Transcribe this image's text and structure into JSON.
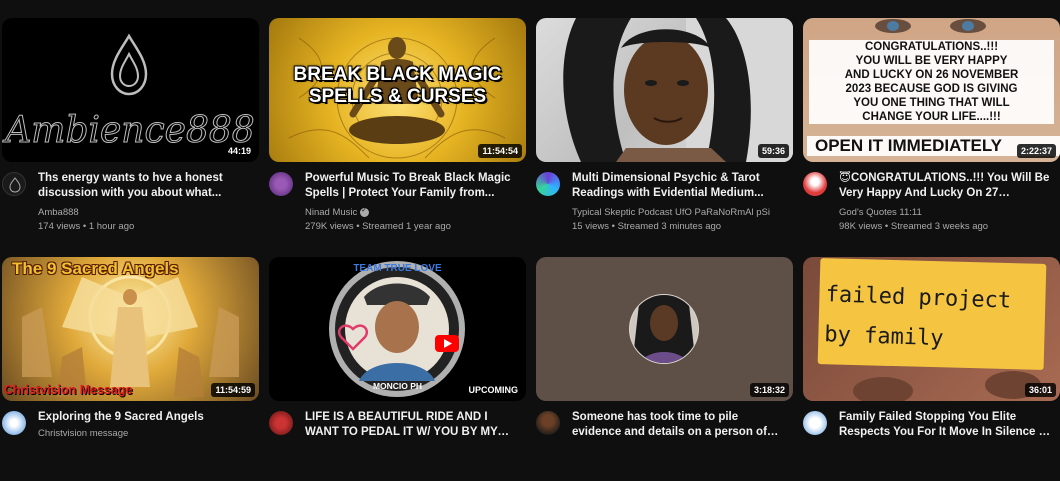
{
  "videos": [
    {
      "thumb_text": "Ambience888",
      "duration": "44:19",
      "title": "Ths energy wants to hve a honest discussion with you about what...",
      "channel": "Amba888",
      "stats": "174 views • 1 hour ago"
    },
    {
      "thumb_text": "BREAK BLACK MAGIC\nSPELLS & CURSES",
      "duration": "11:54:54",
      "title": "Powerful Music To Break Black Magic Spells | Protect Your Family from...",
      "channel": "Ninad Music",
      "stats": "279K views • Streamed 1 year ago"
    },
    {
      "duration": "59:36",
      "title": "Multi Dimensional Psychic & Tarot Readings with Evidential Medium...",
      "channel": "Typical Skeptic Podcast UfO PaRaNoRmAl pSi",
      "stats": "15 views • Streamed 3 minutes ago"
    },
    {
      "thumb_text": "CONGRATULATIONS..!!!\nYOU WILL BE VERY HAPPY\nAND LUCKY ON 26 NOVEMBER\n2023 BECAUSE GOD IS GIVING\nYOU ONE THING THAT WILL\nCHANGE YOUR LIFE....!!!",
      "thumb_text_big": "OPEN IT IMMEDIATELY",
      "duration": "2:22:37",
      "title": "😇CONGRATULATIONS..!!! You Will Be Very Happy And Lucky On 27 November...",
      "channel": "God's Quotes 11:11",
      "stats": "98K views • Streamed 3 weeks ago"
    },
    {
      "thumb_text": "The 9 Sacred Angels",
      "thumb_text_bottom": "Christvision Message",
      "duration": "11:54:59",
      "title": "Exploring the 9 Sacred Angels",
      "channel": "Christvision message",
      "stats": ""
    },
    {
      "thumb_text": "TEAM TRUE LOVE",
      "thumb_text_bottom": "MONCIO PH",
      "duration": "UPCOMING",
      "title": "LIFE IS A BEAUTIFUL RIDE AND I WANT TO PEDAL IT W/ YOU BY MY SIDE...",
      "channel": "",
      "stats": ""
    },
    {
      "duration": "3:18:32",
      "title": "Someone has took time to pile evidence and details on a person of high honor....",
      "channel": "",
      "stats": ""
    },
    {
      "thumb_text": "failed project\nby family",
      "duration": "36:01",
      "title": "Family Failed Stopping You Elite Respects You For It Move In Silence 🌀 Treasure...",
      "channel": "",
      "stats": ""
    }
  ],
  "colors": {
    "background": "#0f0f0f",
    "title": "#f1f1f1",
    "secondary": "#aaaaaa",
    "magic_gold": "#e6b422",
    "angel_gold": "#f0c030",
    "red_text": "#e01b1b",
    "note_yellow": "#f5c542"
  }
}
